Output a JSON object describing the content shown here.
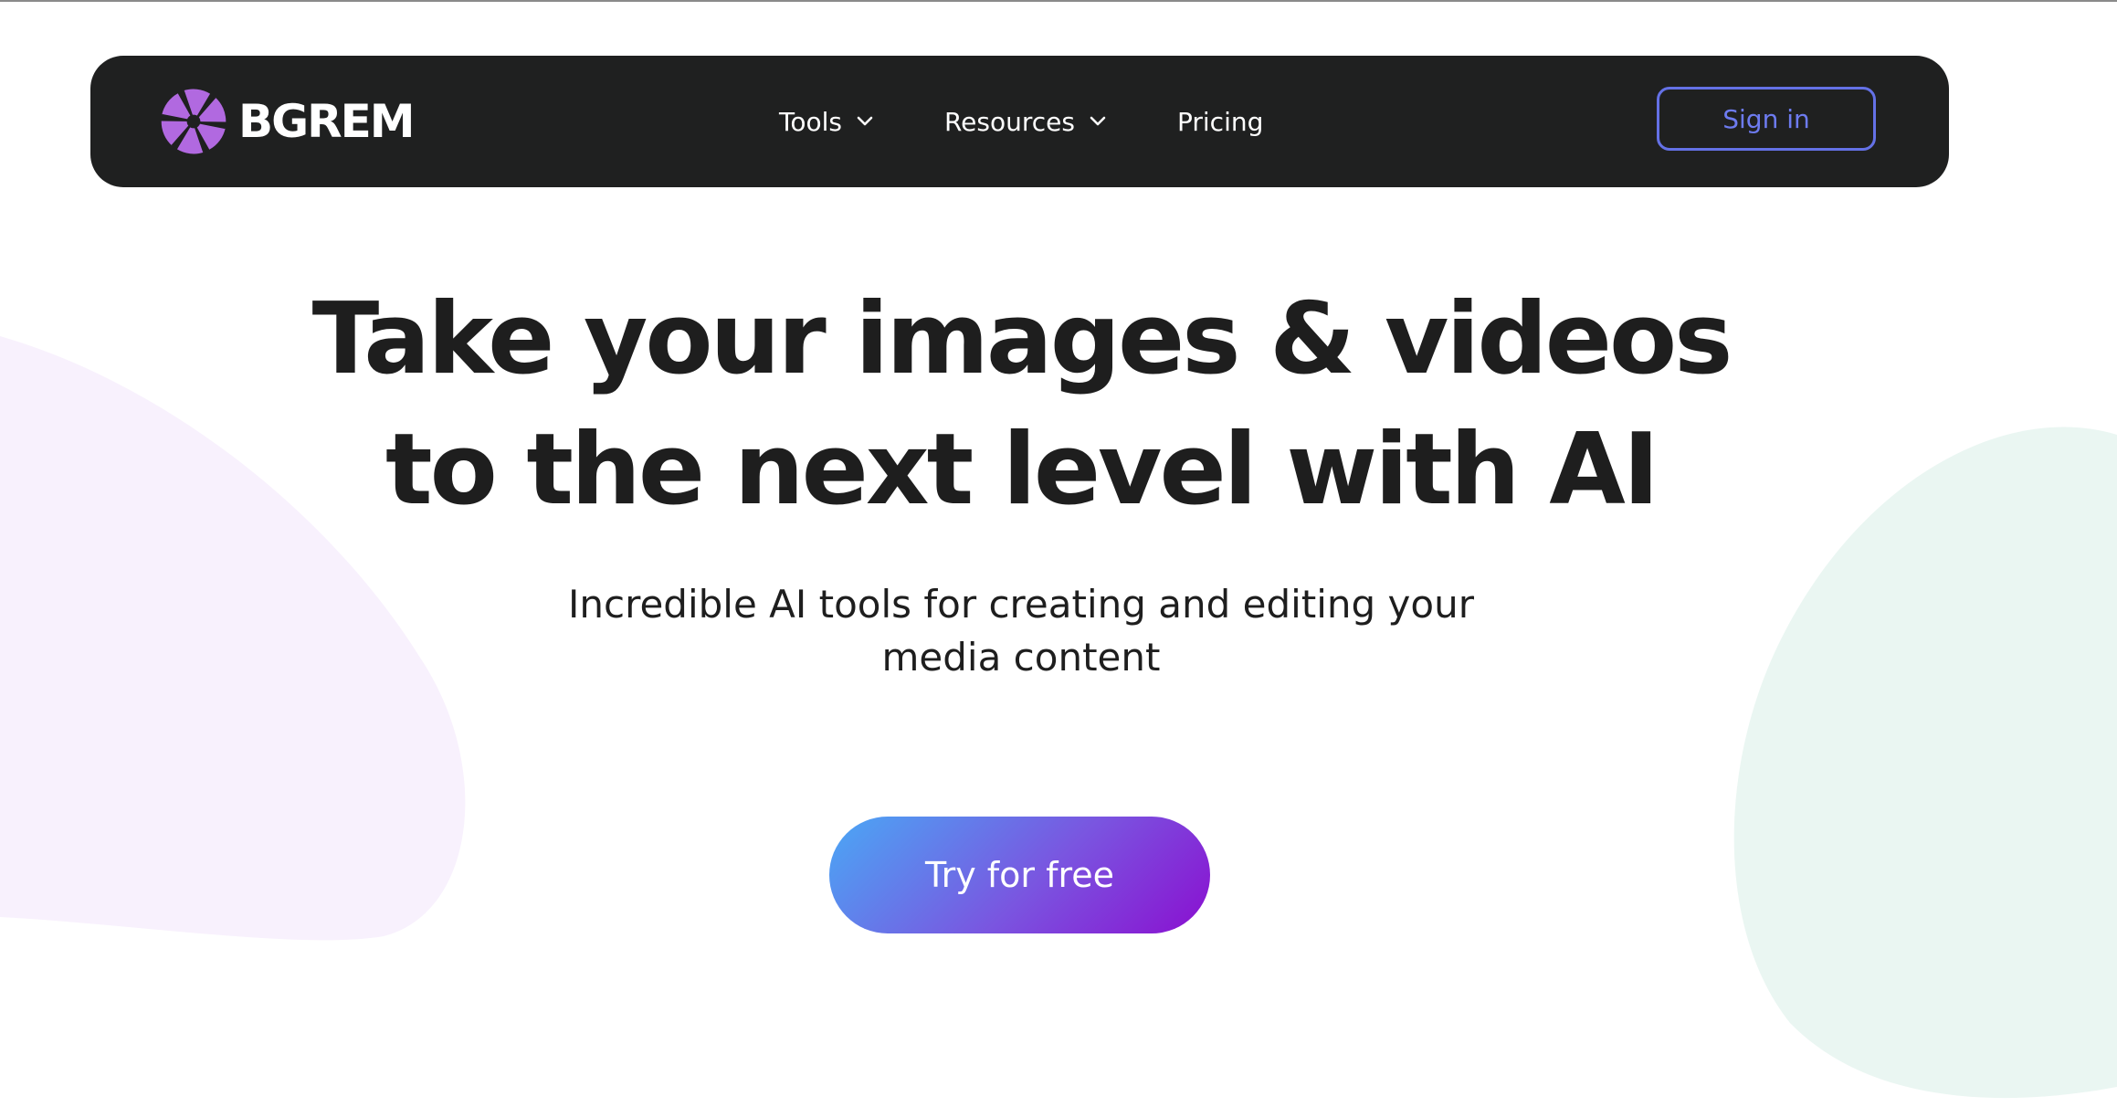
{
  "brand": {
    "name": "BGREM",
    "logo_icon": "aperture-icon",
    "logo_color": "#b169e0"
  },
  "nav": {
    "items": [
      {
        "label": "Tools",
        "has_dropdown": true
      },
      {
        "label": "Resources",
        "has_dropdown": true
      },
      {
        "label": "Pricing",
        "has_dropdown": false
      }
    ],
    "sign_in_label": "Sign in",
    "background": "#1f2020",
    "accent": "#6471e6"
  },
  "hero": {
    "title_line_1": "Take your images & videos",
    "title_line_2": "to the next level with AI",
    "subtitle_line_1": "Incredible AI tools for creating and editing your",
    "subtitle_line_2": "media content",
    "cta_label": "Try for free",
    "cta_gradient": [
      "#4aa8f5",
      "#7a55e0",
      "#8a0fd0"
    ]
  },
  "decor": {
    "left_blob_color": "#f8f1fd",
    "right_blob_color": "#eaf6f2"
  }
}
